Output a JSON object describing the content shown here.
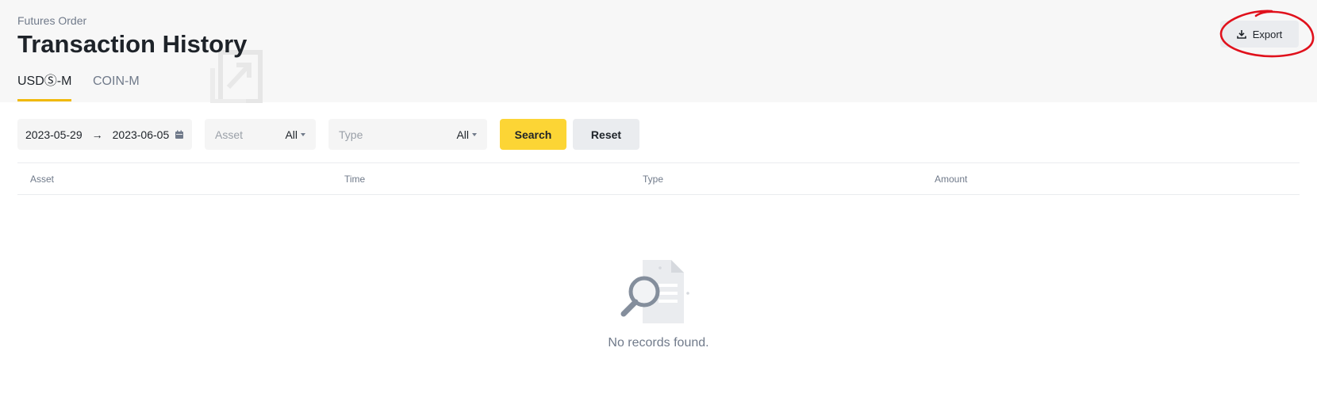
{
  "header": {
    "breadcrumb": "Futures Order",
    "title": "Transaction History",
    "export_label": "Export"
  },
  "tabs": [
    {
      "label": "USDⓈ-M",
      "active": true
    },
    {
      "label": "COIN-M",
      "active": false
    }
  ],
  "filters": {
    "date_start": "2023-05-29",
    "date_end": "2023-06-05",
    "date_separator": "→",
    "asset_placeholder": "Asset",
    "asset_value": "All",
    "type_placeholder": "Type",
    "type_value": "All"
  },
  "buttons": {
    "search_label": "Search",
    "reset_label": "Reset"
  },
  "table": {
    "columns": [
      "Asset",
      "Time",
      "Type",
      "Amount"
    ]
  },
  "empty_state": {
    "message": "No records found."
  },
  "icons": {
    "export": "download-icon",
    "date": "calendar-icon",
    "empty": "search-document-icon"
  },
  "colors": {
    "accent": "#f0b90b",
    "search_button": "#fcd535",
    "annotation": "#e0111c"
  }
}
